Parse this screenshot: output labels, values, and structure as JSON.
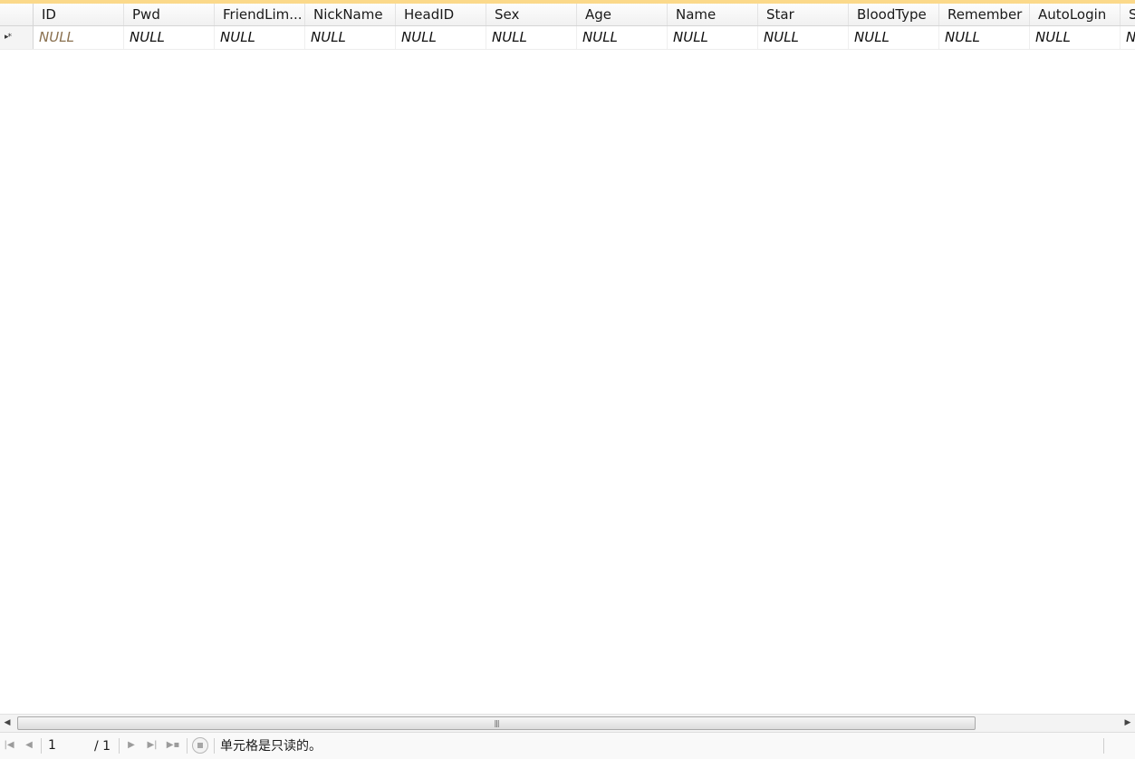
{
  "grid": {
    "columns": [
      "ID",
      "Pwd",
      "FriendLim...",
      "NickName",
      "HeadID",
      "Sex",
      "Age",
      "Name",
      "Star",
      "BloodType",
      "Remember",
      "AutoLogin",
      "S"
    ],
    "new_row_marker": "▸*",
    "null_text": "NULL"
  },
  "status": {
    "page_current": "1",
    "page_total": "/ 1",
    "message": "单元格是只读的。"
  },
  "icons": {
    "first": "first-page-icon",
    "prev": "previous-page-icon",
    "next": "next-page-icon",
    "last": "last-page-icon",
    "add": "add-row-icon",
    "stop": "stop-icon",
    "scroll_left": "scroll-left-icon",
    "scroll_right": "scroll-right-icon",
    "grip": "scrollbar-grip-icon"
  },
  "colors": {
    "accent_top": "#fbd98a",
    "current_cell_text": "#8a7150"
  }
}
